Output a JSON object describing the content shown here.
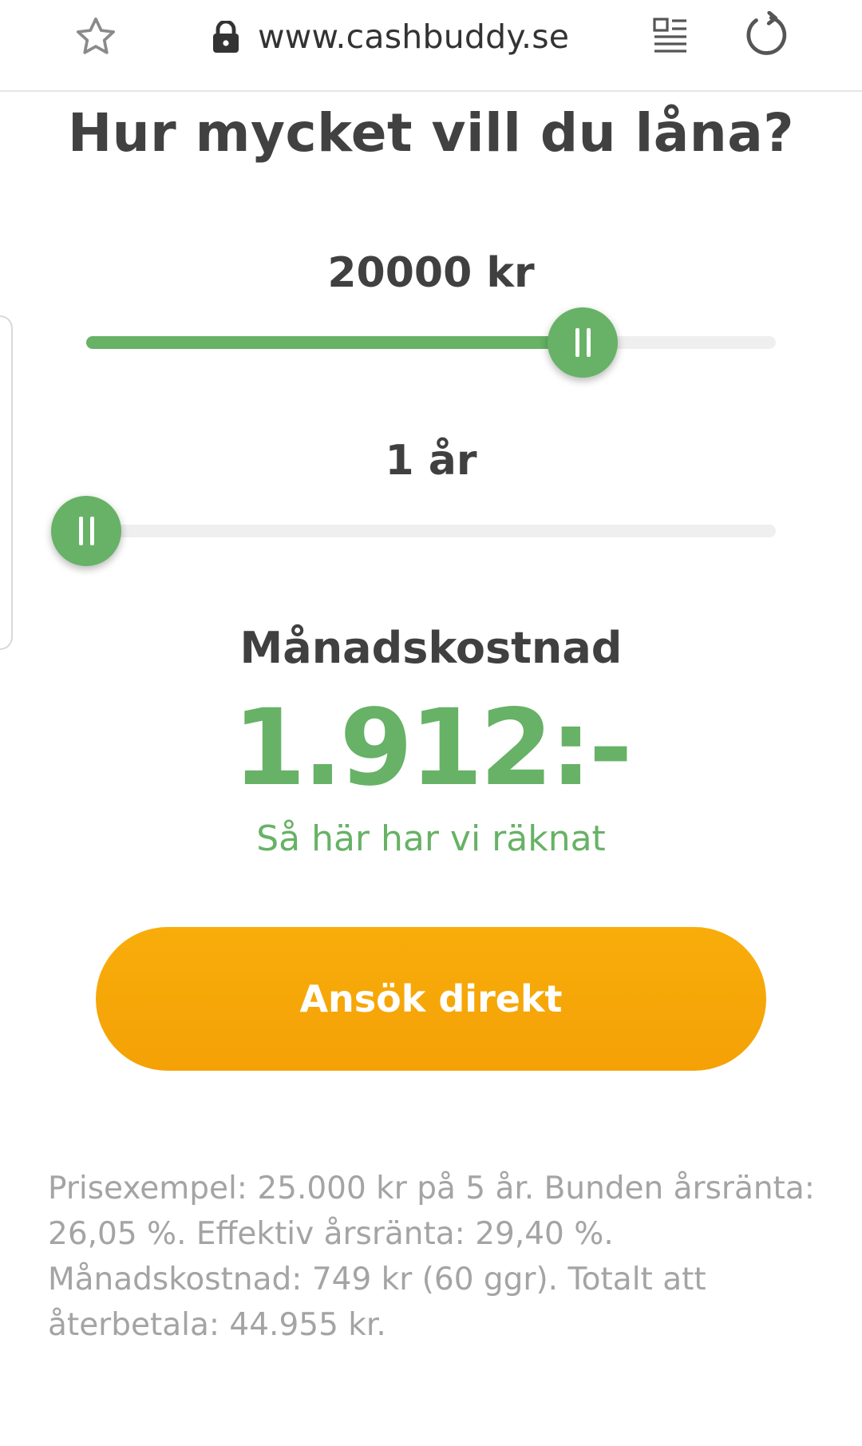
{
  "browser": {
    "url": "www.cashbuddy.se",
    "icons": [
      "star-icon",
      "lock-icon",
      "reader-icon",
      "reload-icon"
    ]
  },
  "page": {
    "title": "Hur mycket vill du låna?"
  },
  "amount_slider": {
    "value_text": "20000 kr",
    "position_fraction": 0.72
  },
  "term_slider": {
    "value_text": "1 år",
    "position_fraction": 0.0
  },
  "result": {
    "label": "Månadskostnad",
    "value": "1.912:-",
    "link_text": "Så här har vi räknat"
  },
  "cta": {
    "label": "Ansök direkt"
  },
  "disclaimer": "Prisexempel: 25.000 kr på 5 år. Bunden årsränta: 26,05 %. Effektiv årsränta: 29,40 %. Månadskostnad: 749 kr (60 ggr). Totalt att återbetala: 44.955 kr.",
  "colors": {
    "green": "#67b266",
    "orange": "#f5a508",
    "text": "#414141",
    "muted": "#a4a4a4"
  }
}
